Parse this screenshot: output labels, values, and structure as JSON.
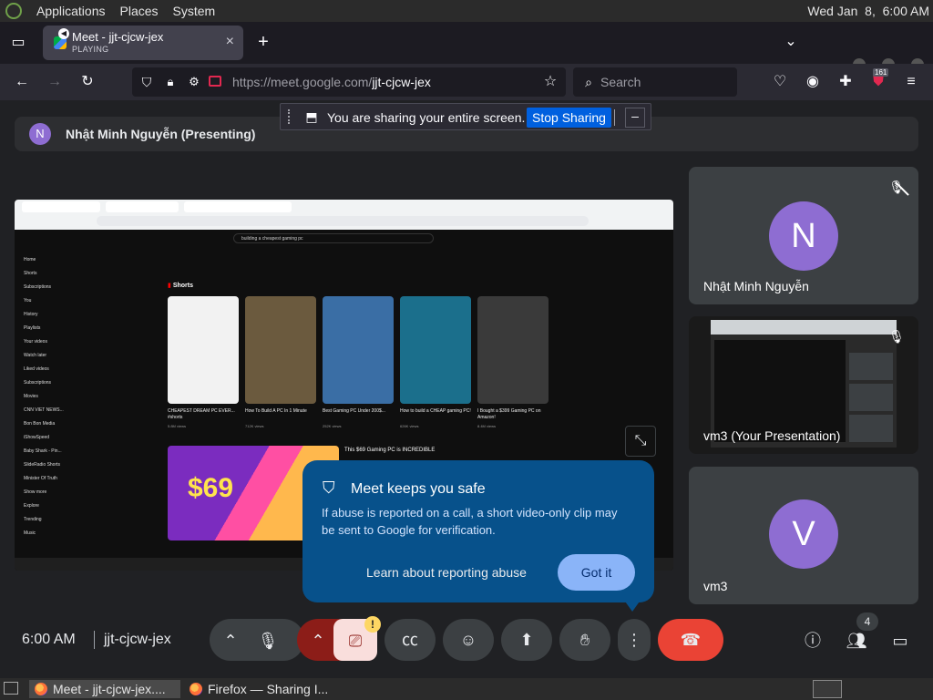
{
  "panel": {
    "menus": [
      "Applications",
      "Places",
      "System"
    ],
    "clock": "Wed Jan  8,  6:00 AM"
  },
  "browser": {
    "tab": {
      "title": "Meet - jjt-cjcw-jex",
      "status": "PLAYING",
      "close": "×"
    },
    "new_tab": "+",
    "url_host": "https://meet.google.com/",
    "url_path": "jjt-cjcw-jex",
    "search_placeholder": "Search",
    "badge_count": "161"
  },
  "sharing_bar": {
    "message": "You are sharing your entire screen.",
    "stop": "Stop Sharing",
    "minimize": "–"
  },
  "presenter": {
    "initial": "N",
    "label": "Nhật Minh Nguyễn (Presenting)"
  },
  "shared_screen": {
    "yt_search": "building a cheapest gaming pc",
    "shorts_header": "Shorts",
    "sidebar": [
      "Home",
      "Shorts",
      "Subscriptions",
      "You",
      "History",
      "Playlists",
      "Your videos",
      "Watch later",
      "Liked videos",
      "Subscriptions",
      "Movies",
      "CNN VIET NEWS...",
      "Bon Bon Media",
      "iShowSpeed",
      "Baby Shark - Pin...",
      "SlideRadio Shorts",
      "Minister Of Truth",
      "Show more",
      "Explore",
      "Trending",
      "Music"
    ],
    "shorts": [
      {
        "title": "CHEAPEST DREAM PC EVER... #shorts",
        "views": "5.8M views",
        "color": "#f2f2f2"
      },
      {
        "title": "How To Build A PC In 1 Minute",
        "views": "712K views",
        "color": "#6b5a3e"
      },
      {
        "title": "Best Gaming PC Under 200$...",
        "views": "252K views",
        "color": "#3a6ea5"
      },
      {
        "title": "How to build a CHEAP gaming PC!",
        "views": "626K views",
        "color": "#1b6f8c"
      },
      {
        "title": "I Bought a $399 Gaming PC on Amazon!",
        "views": "8.4M views",
        "color": "#3a3a3a"
      }
    ],
    "video_title": "This $69 Gaming PC is INCREDIBLE",
    "video_price": "$69"
  },
  "tiles": [
    {
      "initial": "N",
      "name": "Nhật Minh Nguyễn"
    },
    {
      "name": "vm3 (Your Presentation)"
    },
    {
      "initial": "V",
      "name": "vm3"
    }
  ],
  "safety_popup": {
    "title": "Meet keeps you safe",
    "body": "If abuse is reported on a call, a short video-only clip may be sent to Google for verification.",
    "learn": "Learn about reporting abuse",
    "got_it": "Got it"
  },
  "controls": {
    "time": "6:00 AM",
    "meeting_code": "jjt-cjcw-jex",
    "people_count": "4",
    "warning": "!"
  },
  "os_taskbar": {
    "items": [
      "Meet - jjt-cjcw-jex....",
      "Firefox — Sharing I..."
    ]
  },
  "colors": {
    "accent": "#8e6dd2",
    "end_call": "#ea4335",
    "popup": "#07518b",
    "stop_sharing": "#0060df"
  }
}
